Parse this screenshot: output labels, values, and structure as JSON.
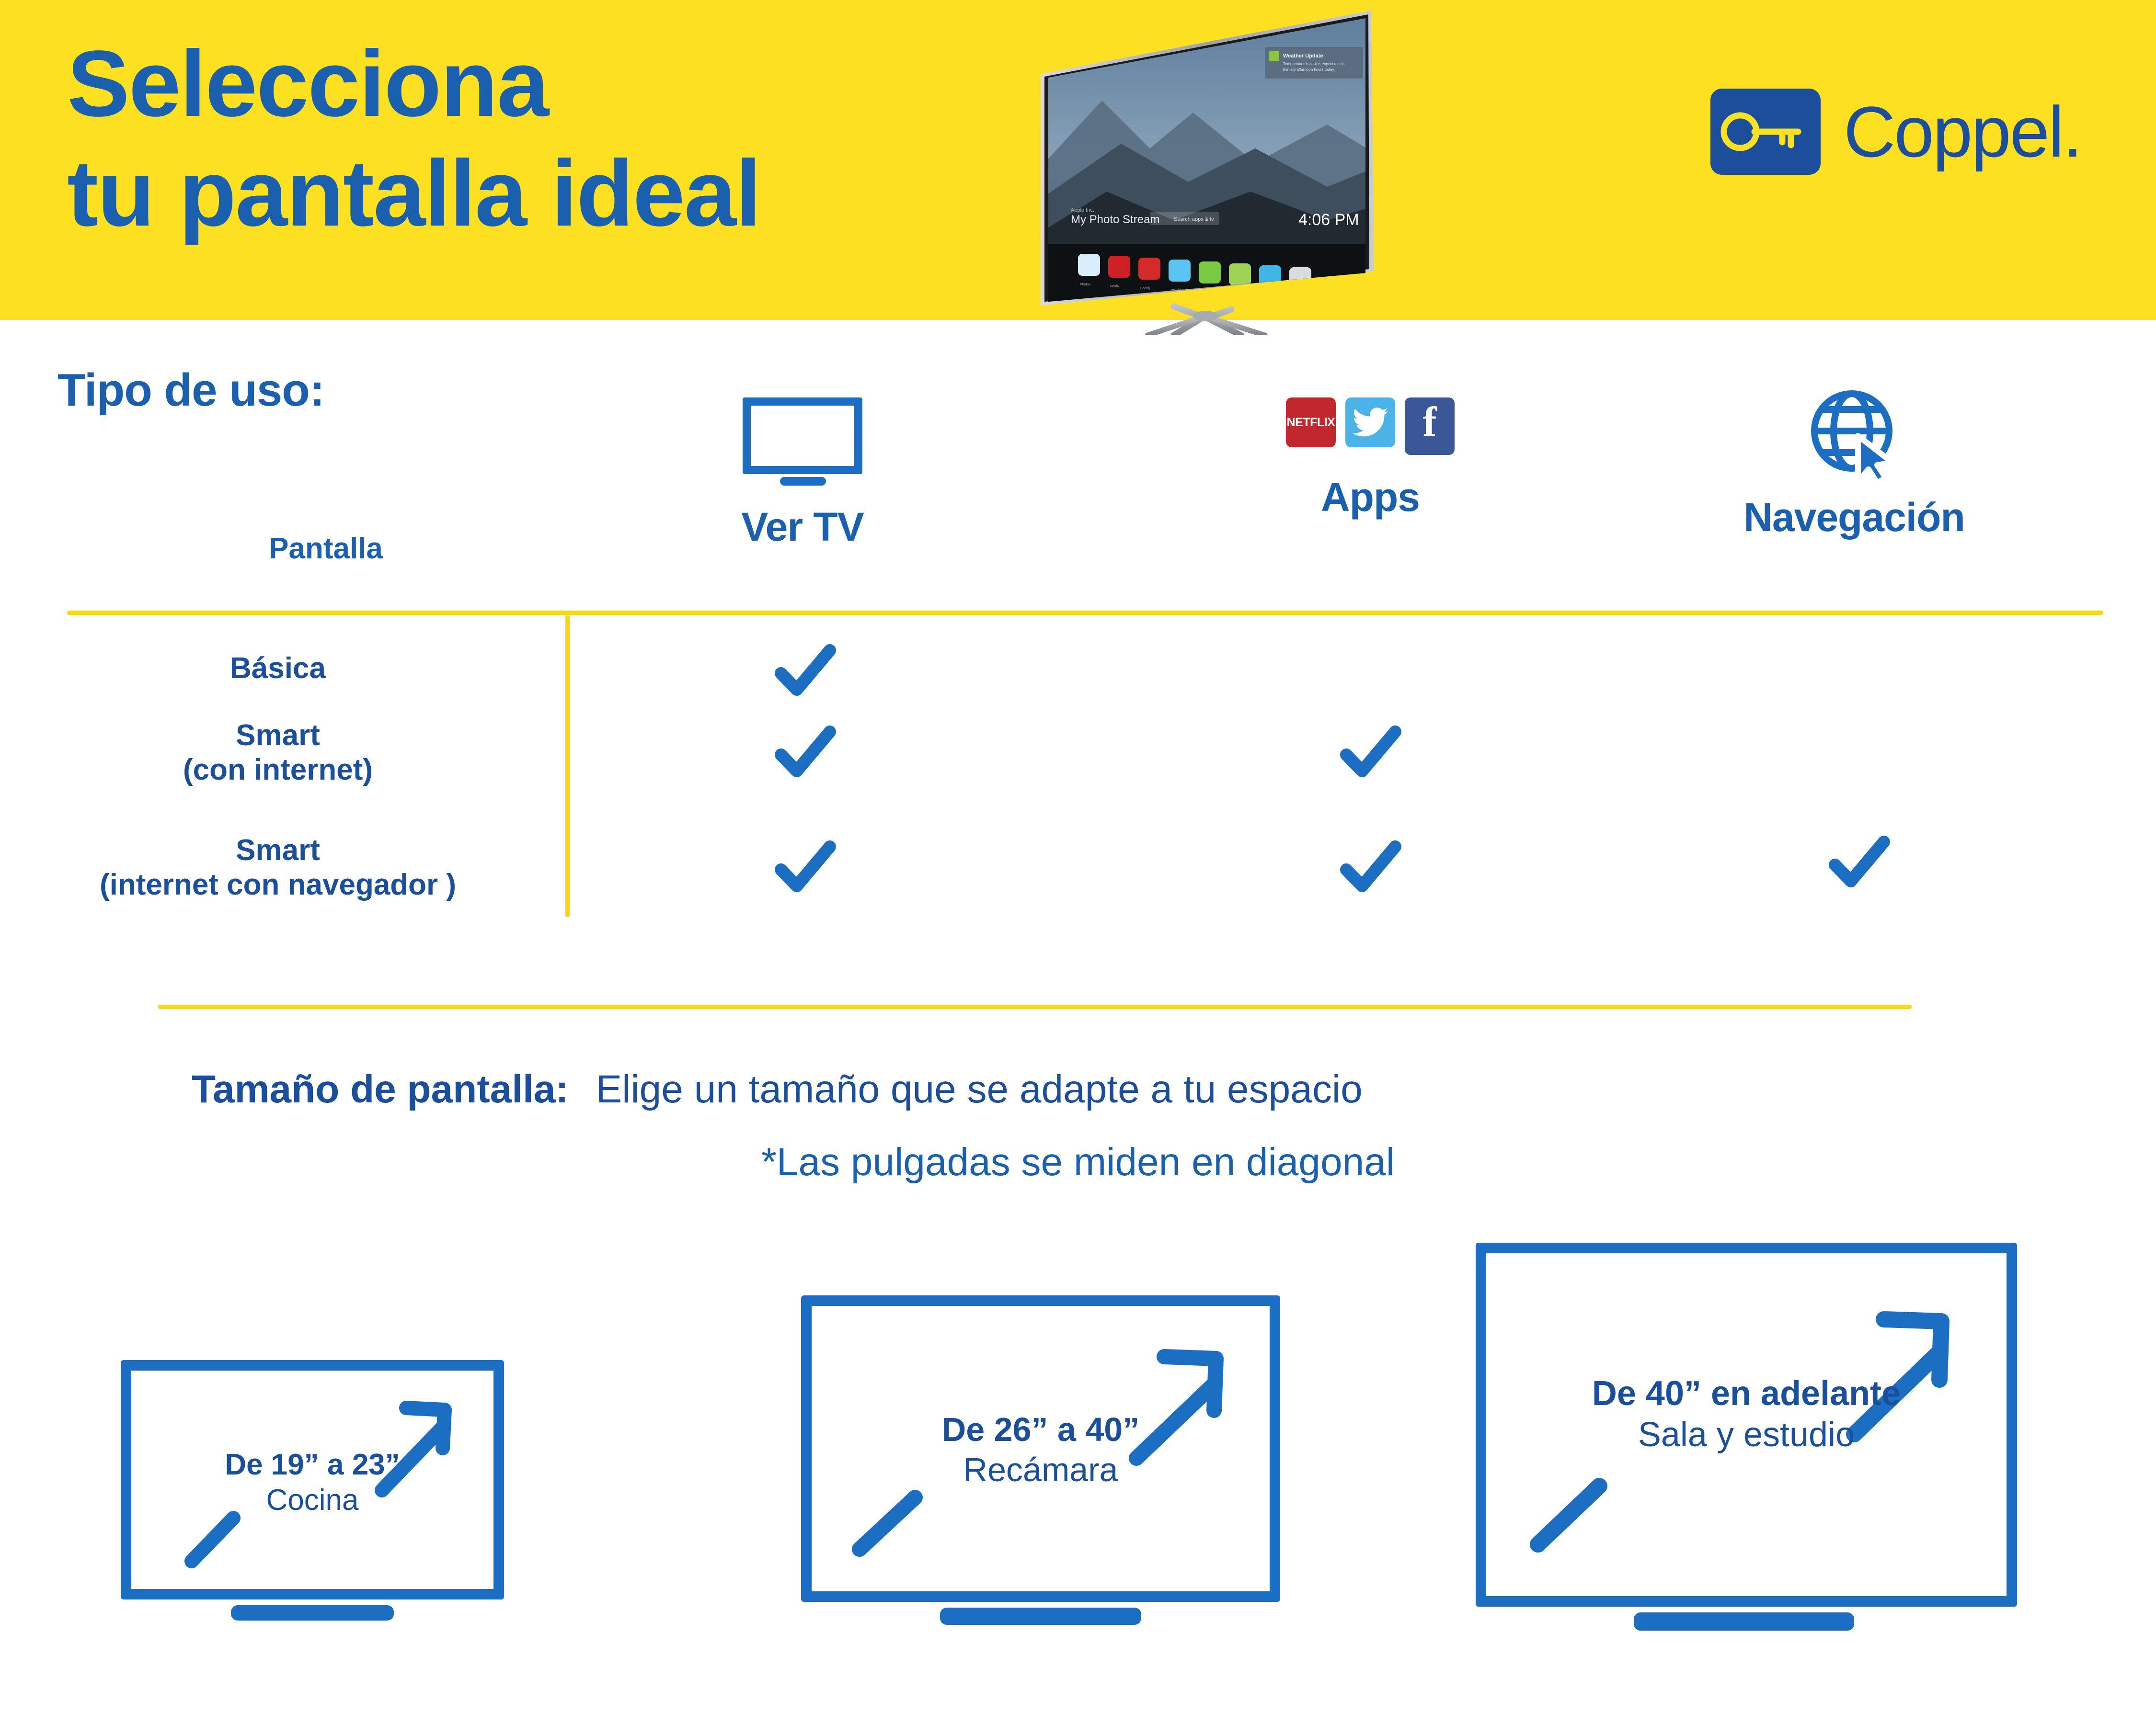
{
  "colors": {
    "brand_yellow": "#FDE021",
    "brand_blue": "#1B4E9B",
    "accent_blue": "#1B6EC2",
    "divider_yellow": "#F5D916",
    "netflix_red": "#C1272D",
    "twitter_blue": "#4BB3E8",
    "facebook_blue": "#3A5897"
  },
  "header": {
    "headline": "Selecciona\ntu pantalla ideal",
    "logo": {
      "wordmark": "Coppel.",
      "icon_name": "key-icon"
    },
    "tv_photo": {
      "screen_title": "My Photo Stream",
      "screen_subtitle": "Apple Inc.",
      "clock": "4:06 PM",
      "search_placeholder": "Search apps & tv",
      "notification_title": "Weather Update",
      "notification_body": "Temperature is cooler, expect rain in the late afternoon hours today.",
      "apps": [
        "Photos",
        "Netflix",
        "Spotify",
        "My Files",
        "Spotify",
        "Hulu Plus",
        "Skype",
        "Settings"
      ]
    }
  },
  "usage_section": {
    "title": "Tipo de uso:",
    "row_header": "Pantalla",
    "columns": [
      {
        "label": "Ver TV",
        "icon": "tv-icon"
      },
      {
        "label": "Apps",
        "icon": "app-logos-icon"
      },
      {
        "label": "Navegación",
        "icon": "globe-cursor-icon"
      }
    ],
    "rows": [
      {
        "label": "Básica",
        "checks": [
          true,
          false,
          false
        ]
      },
      {
        "label": "Smart\n(con internet)",
        "checks": [
          true,
          true,
          false
        ]
      },
      {
        "label": "Smart\n(internet con navegador )",
        "checks": [
          true,
          true,
          true
        ]
      }
    ]
  },
  "size_section": {
    "label": "Tamaño de pantalla:",
    "description": "Elige un tamaño que se adapte a tu espacio",
    "note": "*Las pulgadas se miden en diagonal",
    "boxes": [
      {
        "size": "De 19” a 23”",
        "room": "Cocina"
      },
      {
        "size": "De 26” a 40”",
        "room": "Recámara"
      },
      {
        "size": "De 40” en adelante",
        "room": "Sala y estudio"
      }
    ]
  }
}
